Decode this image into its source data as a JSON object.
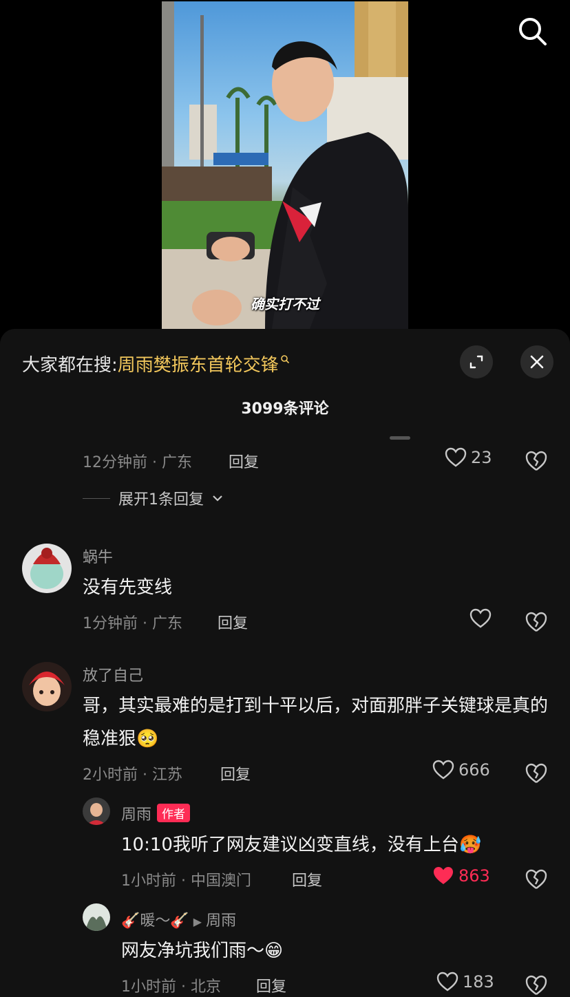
{
  "video": {
    "caption": "确实打不过"
  },
  "sheet": {
    "trending_prefix": "大家都在搜:",
    "trending_keyword": "周雨樊振东首轮交锋",
    "comment_count": "3099条评论"
  },
  "comments": [
    {
      "meta": "12分钟前 · 广东",
      "reply": "回复",
      "likes": "23",
      "expand": "展开1条回复"
    },
    {
      "user": "蜗牛",
      "text": "没有先变线",
      "meta": "1分钟前 · 广东",
      "reply": "回复"
    },
    {
      "user": "放了自己",
      "text": "哥，其实最难的是打到十平以后，对面那胖子关键球是真的稳准狠",
      "emoji": "🥺",
      "meta": "2小时前 · 江苏",
      "reply": "回复",
      "likes": "666"
    }
  ],
  "replies": [
    {
      "user": "周雨",
      "badge": "作者",
      "text": "10:10我听了网友建议凶变直线，没有上台",
      "emoji": "🥵",
      "meta": "1小时前 · 中国澳门",
      "reply": "回复",
      "likes": "863"
    },
    {
      "user": "🎸暖～🎸",
      "reply_to": "周雨",
      "text": "网友净坑我们雨～",
      "emoji": "😁",
      "meta": "1小时前 · 北京",
      "reply": "回复",
      "likes": "183"
    }
  ],
  "colors": {
    "accent": "#fe2c55",
    "keyword": "#f2c75c",
    "sheet_bg": "#121212"
  },
  "icons": [
    "search-icon",
    "expand-icon",
    "close-icon",
    "heart-icon",
    "broken-heart-icon",
    "chevron-down-icon"
  ]
}
